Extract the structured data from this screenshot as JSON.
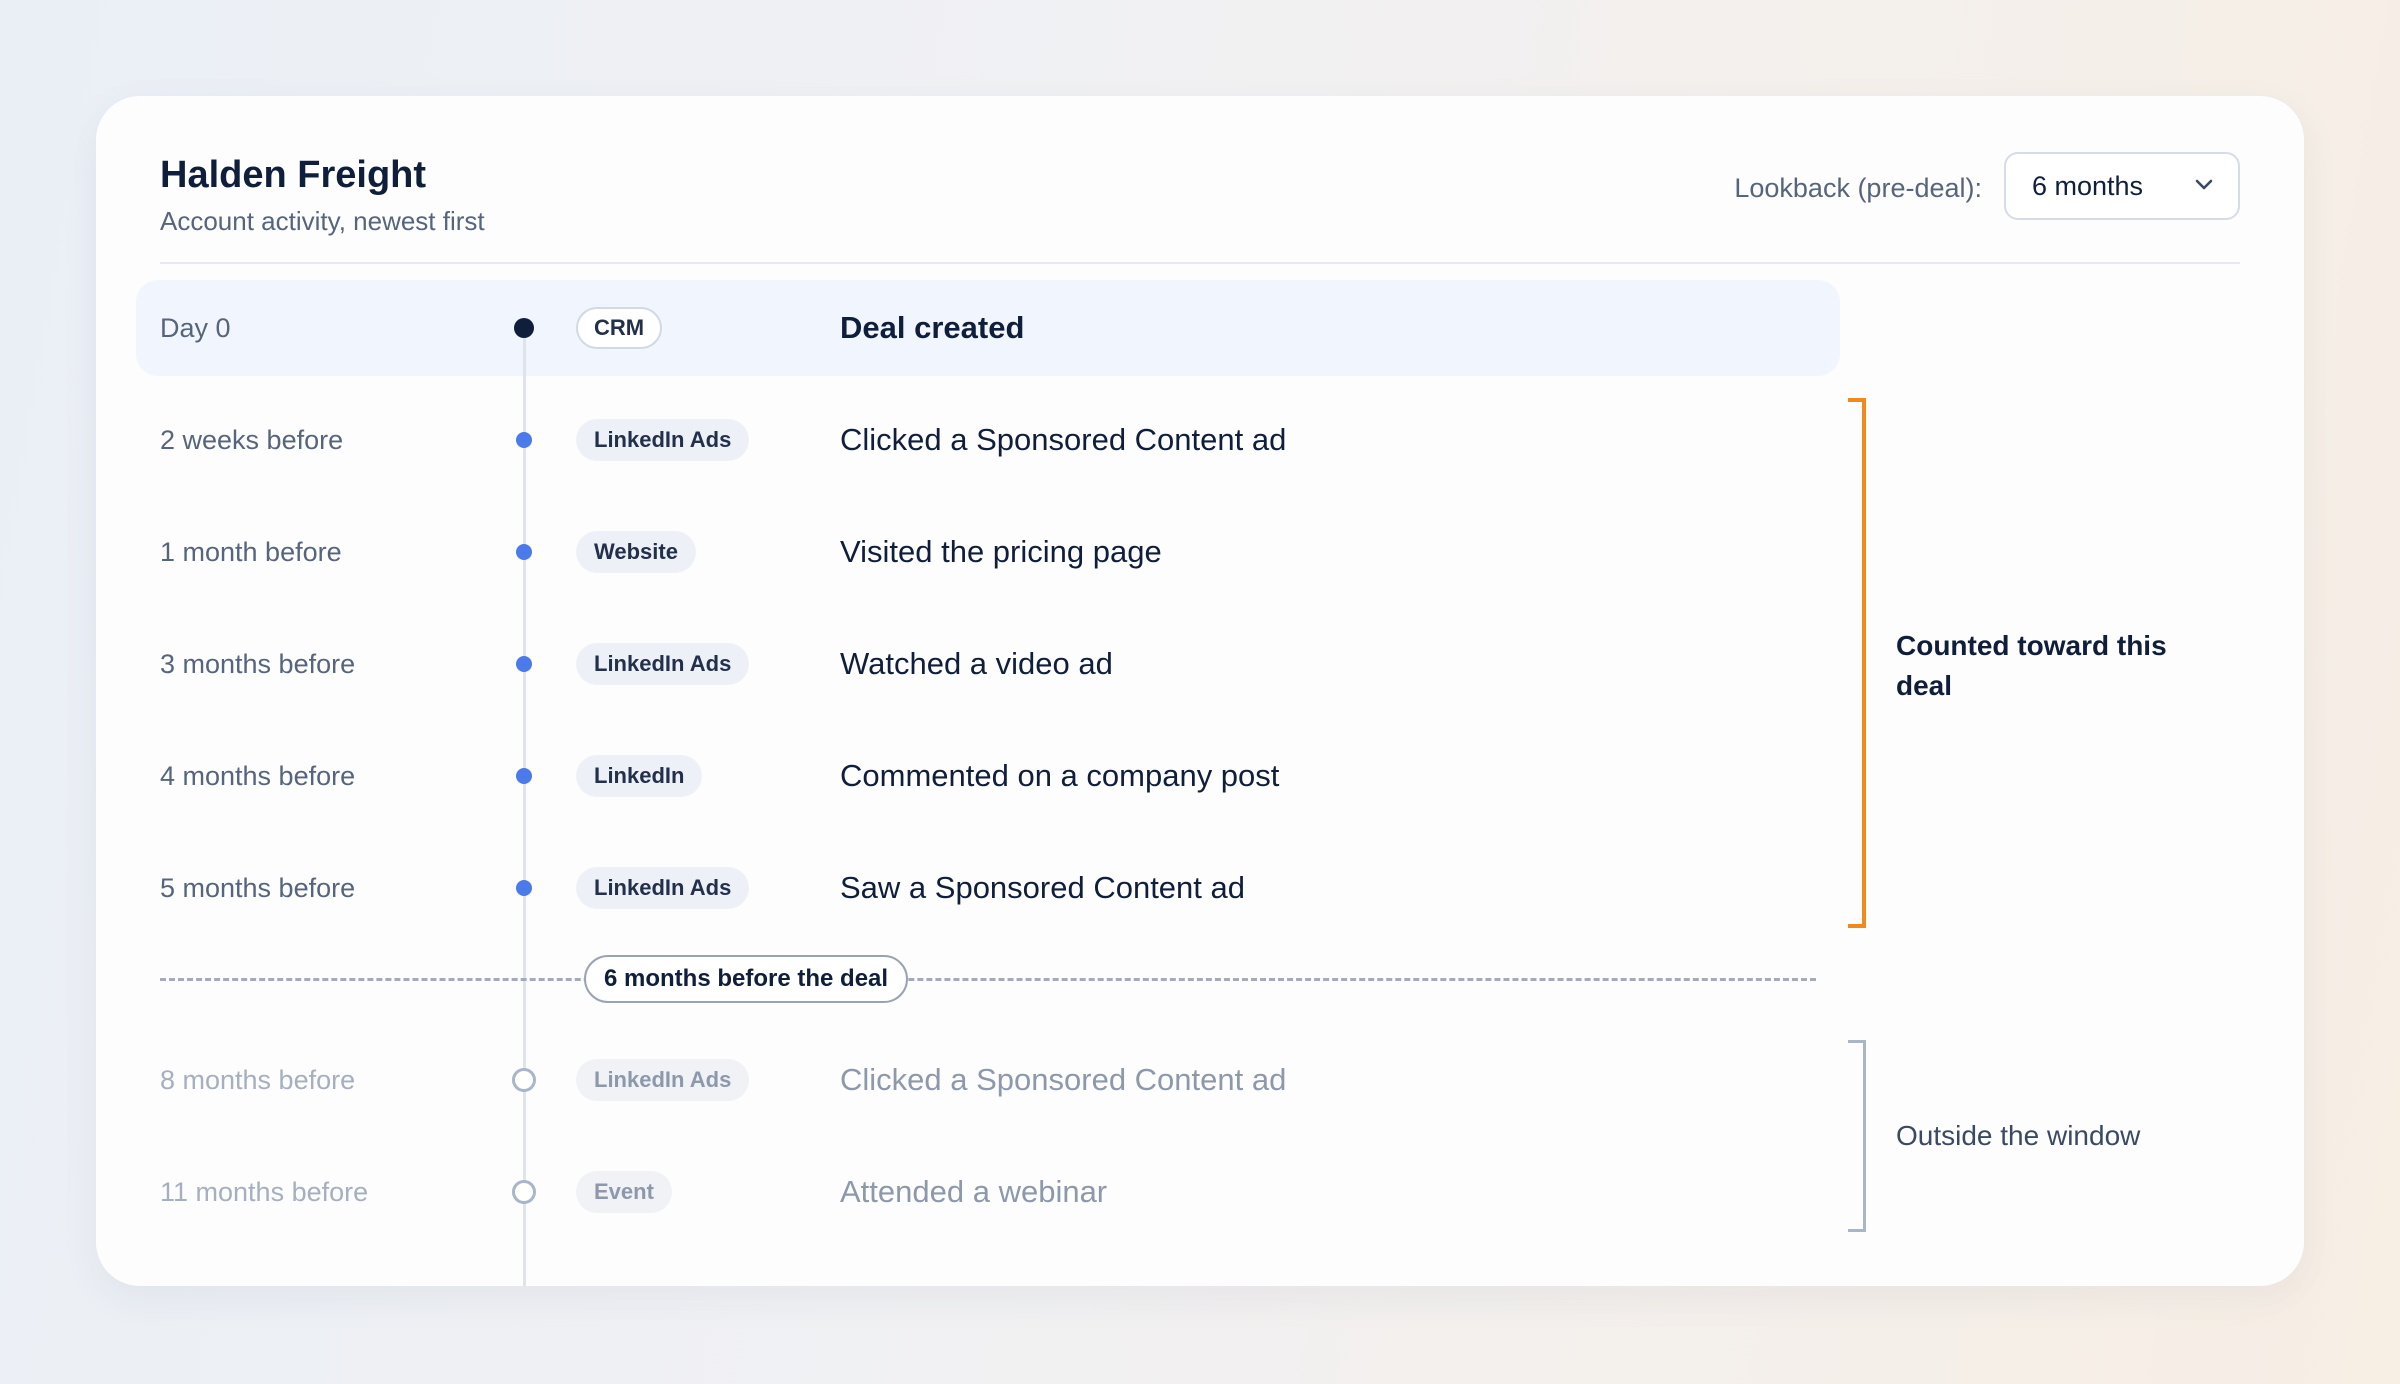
{
  "header": {
    "title": "Halden Freight",
    "subtitle": "Account activity, newest first"
  },
  "lookback": {
    "label": "Lookback (pre-deal):",
    "selected": "6 months",
    "icon": "chevron-down-icon"
  },
  "deal": {
    "when": "Day 0",
    "source": "CRM",
    "event": "Deal created"
  },
  "in_window": [
    {
      "when": "2 weeks before",
      "source": "LinkedIn Ads",
      "event": "Clicked a Sponsored Content ad"
    },
    {
      "when": "1 month before",
      "source": "Website",
      "event": "Visited the pricing page"
    },
    {
      "when": "3 months before",
      "source": "LinkedIn Ads",
      "event": "Watched a video ad"
    },
    {
      "when": "4 months before",
      "source": "LinkedIn",
      "event": "Commented on a company post"
    },
    {
      "when": "5 months before",
      "source": "LinkedIn Ads",
      "event": "Saw a Sponsored Content ad"
    }
  ],
  "cutoff": {
    "label": "6 months before the deal"
  },
  "out_window": [
    {
      "when": "8 months before",
      "source": "LinkedIn Ads",
      "event": "Clicked a Sponsored Content ad"
    },
    {
      "when": "11 months before",
      "source": "Event",
      "event": "Attended a webinar"
    }
  ],
  "brackets": {
    "counted": "Counted toward this deal",
    "outside": "Outside the window"
  },
  "colors": {
    "accent_counted": "#f08a1c",
    "dot_active": "#4a7be8",
    "dot_deal": "#0f1e3a",
    "text_primary": "#0f1e3a",
    "text_muted": "#8d98aa"
  }
}
